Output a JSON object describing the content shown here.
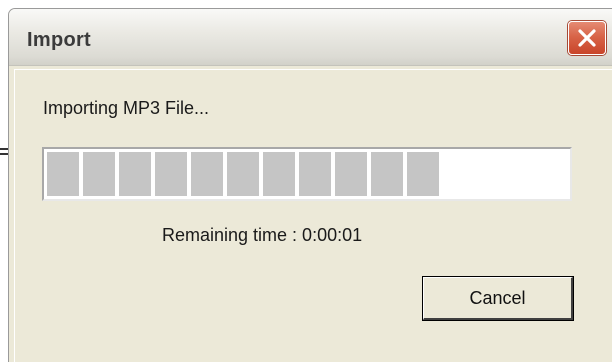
{
  "window": {
    "title": "Import"
  },
  "dialog": {
    "message": "Importing MP3 File...",
    "remaining_label": "Remaining time : 0:00:01",
    "progress_fraction": 0.74,
    "filled_segments": 11,
    "cancel_label": "Cancel"
  },
  "icons": {
    "close": "close-icon"
  },
  "colors": {
    "close_button": "#d86448",
    "progress_segment": "#c5c5c5",
    "dialog_background": "#ece9d8"
  }
}
